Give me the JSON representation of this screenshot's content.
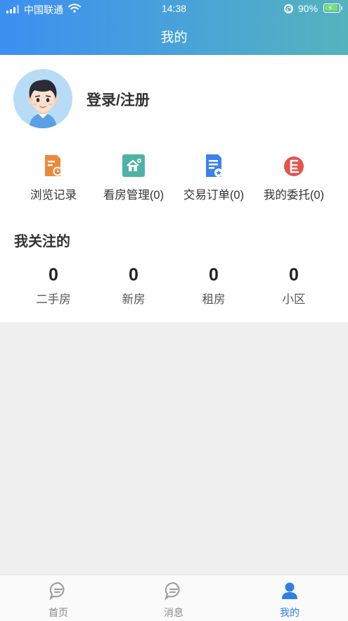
{
  "status_bar": {
    "carrier": "中国联通",
    "time": "14:38",
    "battery": "90%"
  },
  "header": {
    "title": "我的"
  },
  "profile": {
    "login_label": "登录/注册"
  },
  "quick_actions": [
    {
      "label": "浏览记录",
      "icon": "history-icon",
      "color": "#ec8a3a"
    },
    {
      "label": "看房管理(0)",
      "icon": "house-manage-icon",
      "color": "#4db3a4"
    },
    {
      "label": "交易订单(0)",
      "icon": "order-icon",
      "color": "#3b82ec"
    },
    {
      "label": "我的委托(0)",
      "icon": "commission-icon",
      "color": "#e2544d"
    }
  ],
  "follow": {
    "title": "我关注的",
    "items": [
      {
        "count": "0",
        "label": "二手房"
      },
      {
        "count": "0",
        "label": "新房"
      },
      {
        "count": "0",
        "label": "租房"
      },
      {
        "count": "0",
        "label": "小区"
      }
    ]
  },
  "tabbar": {
    "items": [
      {
        "label": "首页",
        "icon": "chat-bubble-icon",
        "active": false
      },
      {
        "label": "消息",
        "icon": "chat-bubble-icon",
        "active": false
      },
      {
        "label": "我的",
        "icon": "person-icon",
        "active": true
      }
    ]
  },
  "colors": {
    "accent": "#2f7fe6",
    "header_start": "#3d8ff0",
    "header_end": "#55b3bd"
  }
}
